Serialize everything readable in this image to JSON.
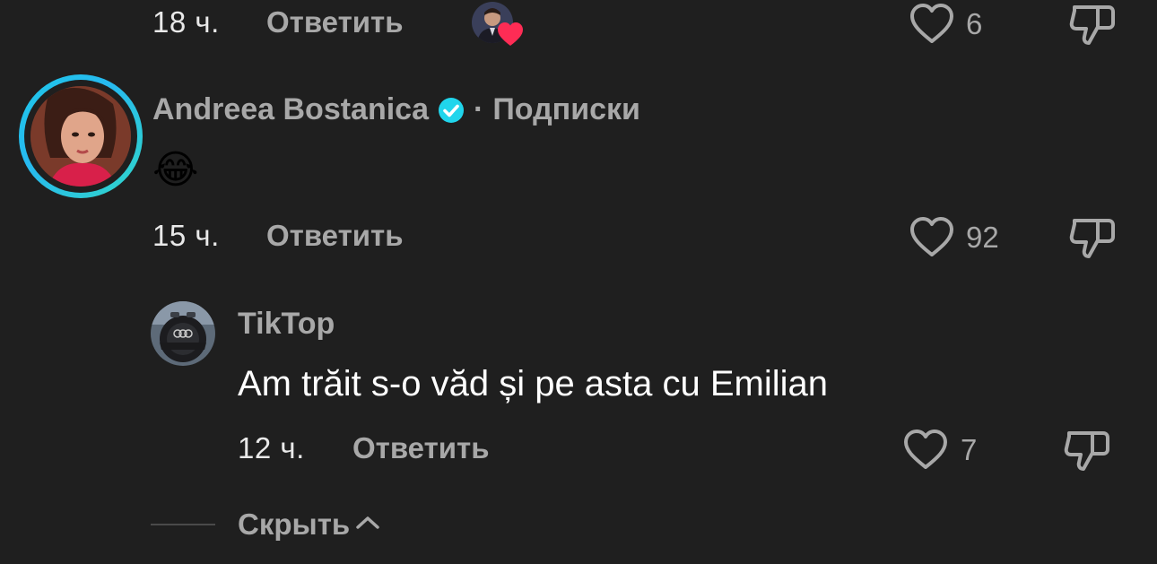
{
  "comments": [
    {
      "time": "18 ч.",
      "reply_label": "Ответить",
      "likes": "6",
      "liked_by_creator": true
    },
    {
      "author": "Andreea Bostanica",
      "verified": true,
      "separator": "·",
      "relation": "Подписки",
      "text": "😂",
      "time": "15 ч.",
      "reply_label": "Ответить",
      "likes": "92"
    },
    {
      "author": "TikTop",
      "text": "Am trăit s-o văd și pe asta cu Emilian",
      "time": "12 ч.",
      "reply_label": "Ответить",
      "likes": "7"
    }
  ],
  "hide_replies_label": "Скрыть",
  "colors": {
    "background": "#1f1f1f",
    "muted_text": "#a8a8a8",
    "verified_badge": "#20d5ec",
    "like_heart": "#fe2c55"
  },
  "icons": [
    "heart-icon",
    "dislike-icon",
    "verified-icon",
    "chevron-up-icon"
  ]
}
